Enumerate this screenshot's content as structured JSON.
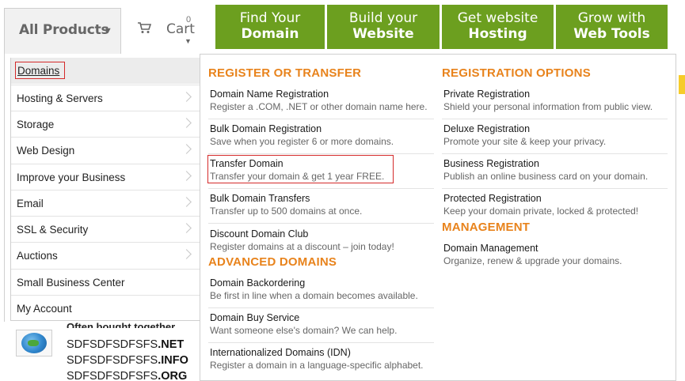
{
  "topbar": {
    "all_products_label": "All Products",
    "all_products_arrow": "▼",
    "cart_label": "Cart",
    "cart_count": "0",
    "cart_arrow": "▼",
    "buttons": [
      {
        "line1": "Find Your",
        "line2": "Domain"
      },
      {
        "line1": "Build your",
        "line2": "Website"
      },
      {
        "line1": "Get website",
        "line2": "Hosting"
      },
      {
        "line1": "Grow with",
        "line2": "Web Tools"
      }
    ],
    "accent_green": "#6c9f1f"
  },
  "left_menu": {
    "items": [
      {
        "label": "Domains"
      },
      {
        "label": "Hosting & Servers"
      },
      {
        "label": "Storage"
      },
      {
        "label": "Web Design"
      },
      {
        "label": "Improve your Business"
      },
      {
        "label": "Email"
      },
      {
        "label": "SSL & Security"
      },
      {
        "label": "Auctions"
      },
      {
        "label": "Small Business Center"
      },
      {
        "label": "My Account"
      }
    ]
  },
  "panel": {
    "register_title": "REGISTER OR TRANSFER",
    "register_items": [
      {
        "title": "Domain Name Registration",
        "desc": "Register a .COM, .NET or other domain name here."
      },
      {
        "title": "Bulk Domain Registration",
        "desc": "Save when you register 6 or more domains."
      },
      {
        "title": "Transfer Domain",
        "desc": "Transfer your domain & get 1 year FREE."
      },
      {
        "title": "Bulk Domain Transfers",
        "desc": "Transfer up to 500 domains at once."
      },
      {
        "title": "Discount Domain Club",
        "desc": "Register domains at a discount – join today!"
      }
    ],
    "advanced_title": "ADVANCED DOMAINS",
    "advanced_items": [
      {
        "title": "Domain Backordering",
        "desc": "Be first in line when a domain becomes available."
      },
      {
        "title": "Domain Buy Service",
        "desc": "Want someone else's domain? We can help."
      },
      {
        "title": "Internationalized Domains (IDN)",
        "desc": "Register a domain in a language-specific alphabet."
      }
    ],
    "options_title": "REGISTRATION OPTIONS",
    "options_items": [
      {
        "title": "Private Registration",
        "desc": "Shield your personal information from public view."
      },
      {
        "title": "Deluxe Registration",
        "desc": "Promote your site & keep your privacy."
      },
      {
        "title": "Business Registration",
        "desc": "Publish an online business card on your domain."
      },
      {
        "title": "Protected Registration",
        "desc": "Keep your domain private, locked & protected!"
      }
    ],
    "management_title": "MANAGEMENT",
    "management_items": [
      {
        "title": "Domain Management",
        "desc": "Organize, renew & upgrade your domains."
      }
    ],
    "section_color": "#e8831c",
    "highlight_color": "#d42a2a"
  },
  "below": {
    "often_label": "Often bought together",
    "domains": [
      {
        "name": "SDFSDFSDFSFS",
        "tld": ".NET"
      },
      {
        "name": "SDFSDFSDFSFS",
        "tld": ".INFO"
      },
      {
        "name": "SDFSDFSDFSFS",
        "tld": ".ORG"
      }
    ]
  }
}
